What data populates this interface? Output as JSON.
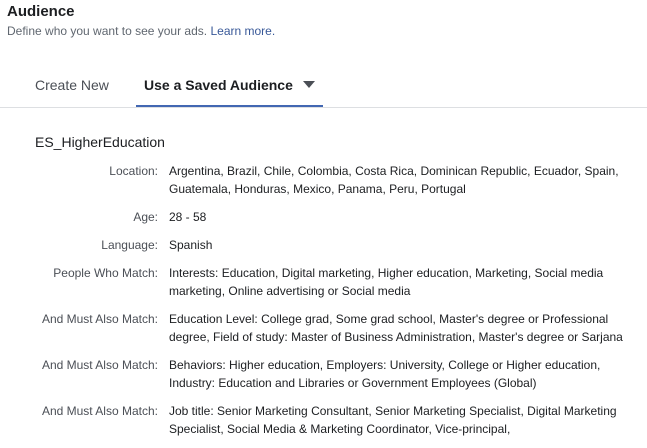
{
  "header": {
    "title": "Audience",
    "subtitle": "Define who you want to see your ads.",
    "learn_more": "Learn more."
  },
  "tabs": {
    "create_new": "Create New",
    "saved_audience": "Use a Saved Audience"
  },
  "audience": {
    "name": "ES_HigherEducation",
    "rows": [
      {
        "label": "Location:",
        "value": "Argentina, Brazil, Chile, Colombia, Costa Rica, Dominican Republic, Ecuador, Spain, Guatemala, Honduras, Mexico, Panama, Peru, Portugal"
      },
      {
        "label": "Age:",
        "value": "28 - 58"
      },
      {
        "label": "Language:",
        "value": "Spanish"
      },
      {
        "label": "People Who Match:",
        "value": "Interests: Education, Digital marketing, Higher education, Marketing, Social media marketing, Online advertising or Social media"
      },
      {
        "label": "And Must Also Match:",
        "value": "Education Level: College grad, Some grad school, Master's degree or Professional degree, Field of study: Master of Business Administration, Master's degree or Sarjana"
      },
      {
        "label": "And Must Also Match:",
        "value": "Behaviors: Higher education, Employers: University, College or Higher education, Industry: Education and Libraries or Government Employees (Global)"
      },
      {
        "label": "And Must Also Match:",
        "value": "Job title: Senior Marketing Consultant, Senior Marketing Specialist, Digital Marketing Specialist, Social Media & Marketing Coordinator, Vice-principal,"
      }
    ]
  },
  "colors": {
    "accent": "#4267b2",
    "link": "#385898",
    "divider": "#dddfe2"
  }
}
